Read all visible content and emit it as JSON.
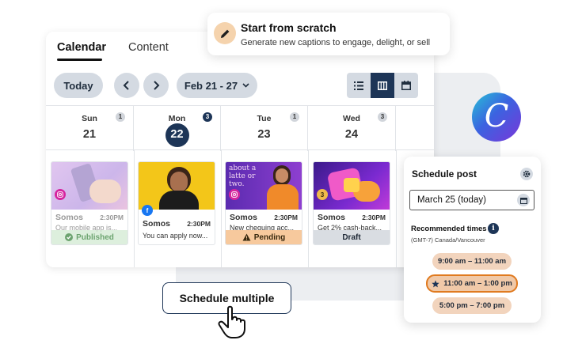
{
  "tabs": [
    {
      "label": "Calendar"
    },
    {
      "label": "Content"
    }
  ],
  "toolbar": {
    "today_label": "Today",
    "date_range": "Feb 21 - 27"
  },
  "days": [
    {
      "name": "Sun",
      "date": "21",
      "count": "1",
      "is_today": false
    },
    {
      "name": "Mon",
      "date": "22",
      "count": "3",
      "is_today": true
    },
    {
      "name": "Tue",
      "date": "23",
      "count": "1",
      "is_today": false
    },
    {
      "name": "Wed",
      "date": "24",
      "count": "3",
      "is_today": false
    }
  ],
  "posts": [
    {
      "network": "instagram",
      "brand": "Somos",
      "time": "2:30PM",
      "text": "Our mobile app is...",
      "status": "Published",
      "status_icon": "check-circle-icon"
    },
    {
      "network": "facebook",
      "brand": "Somos",
      "time": "2:30PM",
      "text": "You can apply now...",
      "status": "",
      "status_icon": ""
    },
    {
      "network": "instagram",
      "brand": "Somos",
      "time": "2:30PM",
      "text": "New chequing acc...",
      "status": "Pending",
      "status_icon": "warning-icon",
      "image_text": "about a latte or two."
    },
    {
      "network": "stack",
      "stack_count": "3",
      "brand": "Somos",
      "time": "2:30PM",
      "text": "Get 2% cash-back...",
      "status": "Draft",
      "status_icon": ""
    }
  ],
  "scratch": {
    "title": "Start from scratch",
    "subtitle": "Generate new captions to engage, delight, or sell",
    "icon": "pencil-icon"
  },
  "schedule": {
    "title": "Schedule post",
    "date_value": "March 25 (today)",
    "recommended_label": "Recommended times",
    "info_glyph": "i",
    "timezone": "(GMT-7) Canada/Vancouver",
    "slots": [
      {
        "label": "9:00 am – 11:00 am",
        "selected": false
      },
      {
        "label": "11:00 am – 1:00 pm",
        "selected": true
      },
      {
        "label": "5:00 pm – 7:00 pm",
        "selected": false
      }
    ]
  },
  "multi_button": "Schedule multiple",
  "logo_letter": "C",
  "colors": {
    "navy": "#1d3557",
    "pending": "#f7c99d",
    "published": "#cfe9cf",
    "draft": "#d9dde2",
    "slot": "#f2d4bd",
    "slot_border": "#e07a1f"
  }
}
